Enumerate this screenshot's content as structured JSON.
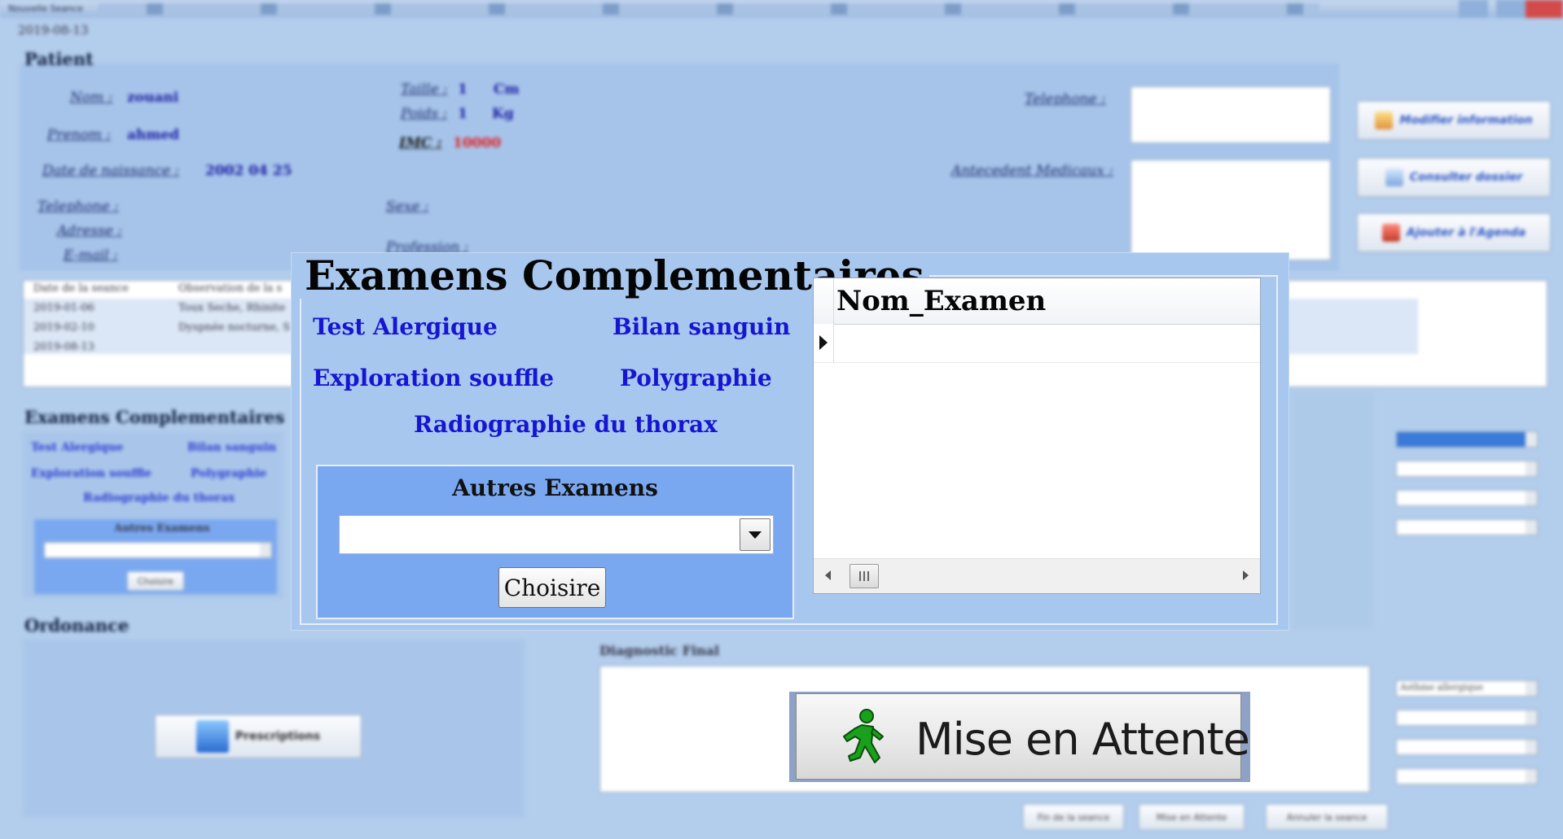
{
  "background": {
    "window_title": "Nouvelle Seance",
    "date": "2019-08-13",
    "patient_section": "Patient",
    "fields": {
      "nom_label": "Nom :",
      "nom_value": "zouani",
      "prenom_label": "Prenom :",
      "prenom_value": "ahmed",
      "naissance_label": "Date de naissance :",
      "naissance_value": "2002 04 25",
      "telephone_label": "Telephone :",
      "adresse_label": "Adresse :",
      "email_label": "E-mail :",
      "taille_label": "Taille :",
      "taille_value": "1",
      "taille_unit": "Cm",
      "poids_label": "Poids :",
      "poids_value": "1",
      "poids_unit": "Kg",
      "imc_label": "IMC :",
      "imc_value": "10000",
      "sexe_label": "Sexe :",
      "profession_label": "Profession :",
      "telephone2_label": "Telephone :",
      "antecedent_label": "Antecedent Medicaux :"
    },
    "side_buttons": [
      "Modifier information",
      "Consulter dossier",
      "Ajouter à l'Agenda"
    ],
    "history": {
      "headers": [
        "Date de la seance",
        "Observation de la s"
      ],
      "rows": [
        [
          "2019-01-06",
          "Toux Seche, Rhinite"
        ],
        [
          "2019-02-10",
          "Dyspnée nocturne, S"
        ],
        [
          "2019-08-13",
          ""
        ]
      ]
    },
    "exams_section": "Examens Complementaires",
    "exam_links": [
      "Test Alergique",
      "Bilan sanguin",
      "Exploration souffle",
      "Polygraphie",
      "Radiographie du thorax"
    ],
    "autres_label": "Autres Examens",
    "choisir_label": "Choisire",
    "ordonance_section": "Ordonance",
    "prescription_btn": "Prescriptions",
    "diagnostic_label": "Diagnostic Final",
    "right_combo_1": "Asthme allergique",
    "right_combo_top": "",
    "bottom_buttons": [
      "Fin de la seance",
      "Mise en Attente",
      "Annuler la seance"
    ]
  },
  "dialog": {
    "title": "Examens Complementaires",
    "links": {
      "test_alergique": "Test Alergique",
      "bilan_sanguin": "Bilan sanguin",
      "exploration_souffle": "Exploration souffle",
      "polygraphie": "Polygraphie",
      "radiographie": "Radiographie du thorax"
    },
    "autres": {
      "title": "Autres Examens",
      "selected": "",
      "button": "Choisire"
    },
    "grid": {
      "column": "Nom_Examen"
    }
  },
  "attente_button": {
    "label": "Mise en Attente",
    "icon": "walking-man-icon"
  },
  "colors": {
    "page_bg": "#b3cdec",
    "dialog_bg": "#a8c7ee",
    "link_blue": "#1616d2",
    "autres_bg": "#7aa8f0",
    "walker_green": "#19a11c"
  }
}
